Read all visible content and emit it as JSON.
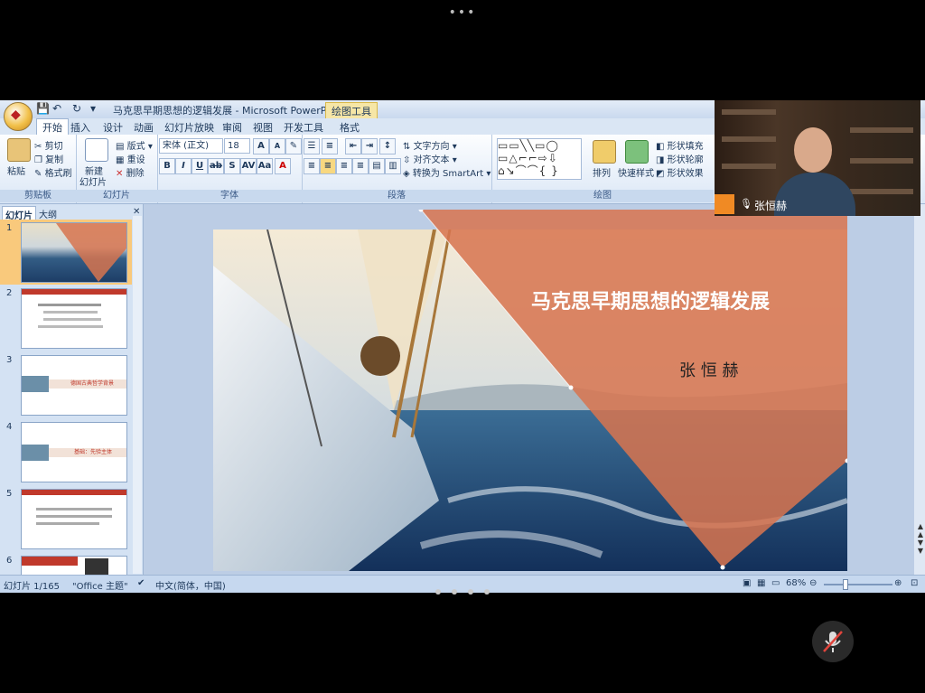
{
  "window": {
    "title": "马克思早期思想的逻辑发展 - Microsoft PowerPoi...",
    "context_tab": "绘图工具"
  },
  "tabs": [
    "开始",
    "插入",
    "设计",
    "动画",
    "幻灯片放映",
    "审阅",
    "视图",
    "开发工具",
    "格式"
  ],
  "ribbon": {
    "clipboard": {
      "paste": "粘贴",
      "cut": "剪切",
      "copy": "复制",
      "format_painter": "格式刷",
      "label": "剪贴板"
    },
    "slides": {
      "new_slide_1": "新建",
      "new_slide_2": "幻灯片",
      "layout": "版式",
      "reset": "重设",
      "delete": "删除",
      "label": "幻灯片"
    },
    "font": {
      "font_name": "宋体 (正文)",
      "font_size": "18",
      "label": "字体"
    },
    "paragraph": {
      "text_direction": "文字方向",
      "align_text": "对齐文本",
      "smartart": "转换为 SmartArt",
      "label": "段落"
    },
    "drawing": {
      "arrange": "排列",
      "quick_styles": "快速样式",
      "shape_fill": "形状填充",
      "shape_outline": "形状轮廓",
      "shape_effects": "形状效果",
      "label": "绘图"
    }
  },
  "panel": {
    "tab_slides": "幻灯片",
    "tab_outline": "大纲",
    "close": "✕",
    "slide_numbers": [
      "1",
      "2",
      "3",
      "4",
      "5",
      "6"
    ],
    "thumb3_text": "德国古典哲学背景",
    "thumb4_text": "基础：先验主体"
  },
  "slide": {
    "title": "马克思早期思想的逻辑发展",
    "author": "张 恒 赫"
  },
  "statusbar": {
    "slide_count": "幻灯片 1/165",
    "theme": "\"Office 主题\"",
    "language": "中文(简体，中国)",
    "zoom": "68%"
  },
  "video": {
    "name": "张恒赫"
  },
  "colors": {
    "slide_orange": "#d7744f",
    "ribbon_blue": "#dbe7f6",
    "status_blue": "#c6d8ef"
  }
}
